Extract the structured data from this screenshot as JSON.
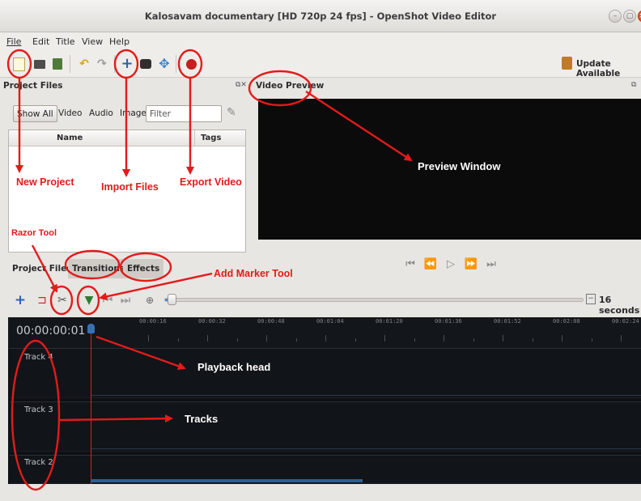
{
  "window": {
    "title": "Kalosavam documentary [HD 720p 24 fps] - OpenShot Video Editor",
    "btn_min": "–",
    "btn_max": "▢",
    "btn_close": "×"
  },
  "menu": [
    "File",
    "Edit",
    "Title",
    "View",
    "Help"
  ],
  "toolbar": {
    "update_label": "Update Available",
    "icons": [
      "new-project-icon",
      "open-project-icon",
      "save-project-icon",
      "undo-icon",
      "redo-icon",
      "import-files-icon",
      "profile-icon",
      "fullscreen-icon",
      "export-video-icon"
    ]
  },
  "project_files": {
    "title": "Project Files",
    "filters": [
      "Show All",
      "Video",
      "Audio",
      "Image"
    ],
    "filter_placeholder": "Filter",
    "columns": [
      "Name",
      "Tags"
    ]
  },
  "bottom_tabs": [
    "Project Files",
    "Transitions",
    "Effects"
  ],
  "video_preview": {
    "title": "Video Preview"
  },
  "timeline": {
    "timecode": "00:00:00:01",
    "zoom_label": "16 seconds",
    "ruler_labels": [
      "00:00:16",
      "00:00:32",
      "00:00:48",
      "00:01:04",
      "00:01:20",
      "00:01:36",
      "00:01:52",
      "00:02:08",
      "00:02:24"
    ],
    "tracks": [
      "Track 4",
      "Track 3",
      "Track 2"
    ]
  },
  "annotations": {
    "new_project": "New Project",
    "import_files": "Import Files",
    "export_video": "Export Video",
    "preview_window": "Preview Window",
    "razor_tool": "Razor Tool",
    "add_marker_tool": "Add Marker Tool",
    "playback_head": "Playback head",
    "tracks": "Tracks"
  },
  "colors": {
    "annotation_red": "#e21b1b",
    "timeline_bg": "#0e1013",
    "preview_bg": "#0b0b0c",
    "playhead": "#b83232"
  }
}
